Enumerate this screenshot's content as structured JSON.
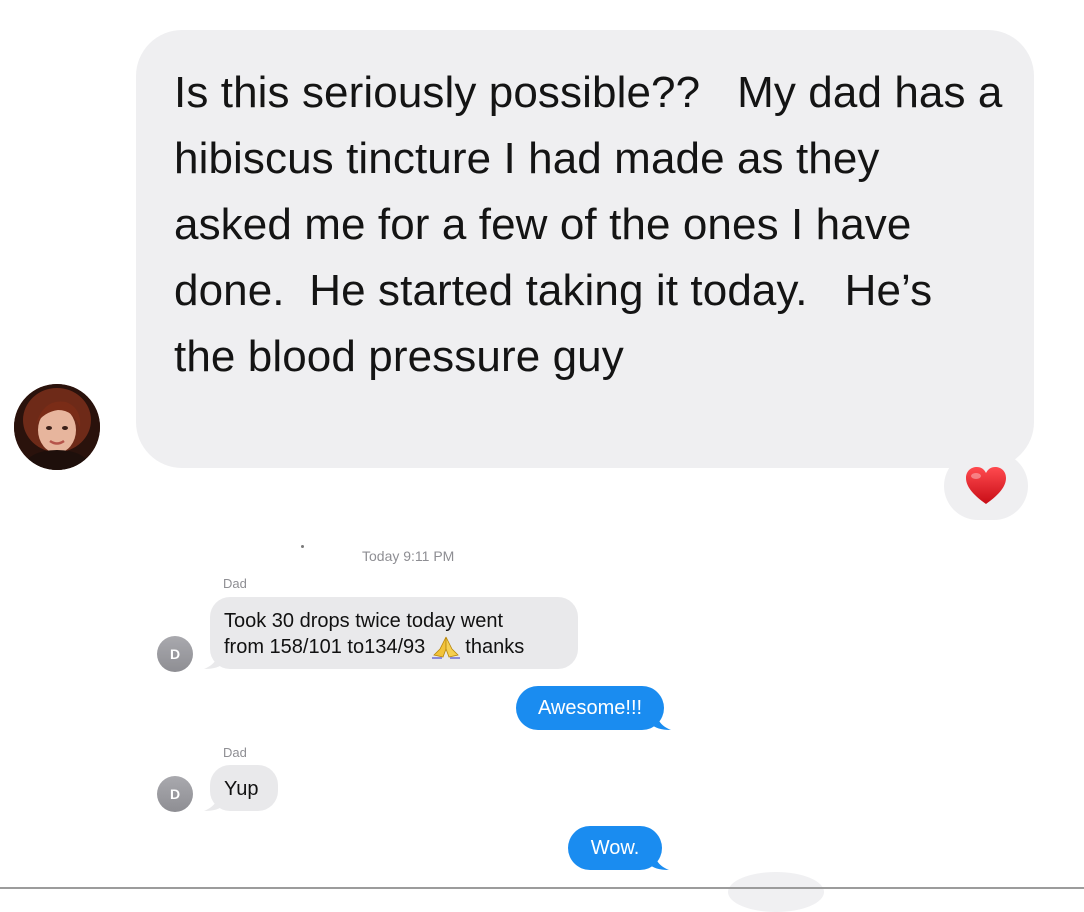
{
  "post": {
    "text": "Is this seriously possible??   My dad has a hibiscus tincture I had made as they asked me for a few of the ones I have done.  He started taking it today.   He’s the blood pressure guy",
    "reaction": "heart",
    "colors": {
      "bubble": "#efeff1",
      "heart": "#e8161f"
    }
  },
  "thread": {
    "timestamp": "Today 9:11 PM",
    "messages": [
      {
        "direction": "incoming",
        "sender": "Dad",
        "avatar_initial": "D",
        "line1": "Took 30 drops twice today went",
        "line2_before": "from 158/101 to134/93",
        "line2_emoji": "folded-hands",
        "line2_after": "thanks"
      },
      {
        "direction": "outgoing",
        "text": "Awesome!!!"
      },
      {
        "direction": "incoming",
        "sender": "Dad",
        "avatar_initial": "D",
        "text": "Yup"
      },
      {
        "direction": "outgoing",
        "text": "Wow."
      }
    ],
    "colors": {
      "incoming": "#e9e9eb",
      "outgoing": "#1a8cf0"
    }
  }
}
